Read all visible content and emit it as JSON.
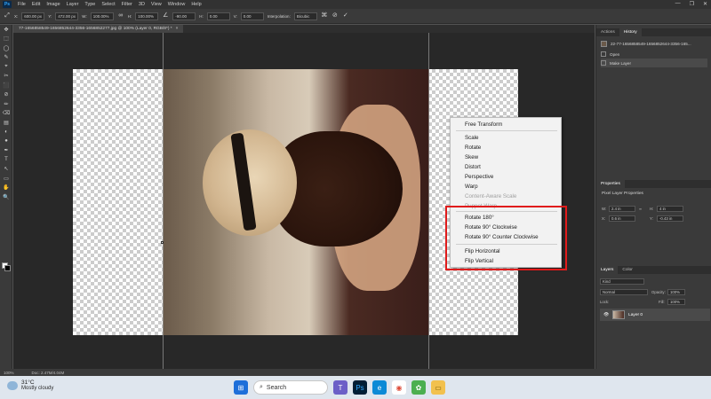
{
  "menubar": {
    "logo": "Ps",
    "items": [
      "File",
      "Edit",
      "Image",
      "Layer",
      "Type",
      "Select",
      "Filter",
      "3D",
      "View",
      "Window",
      "Help"
    ],
    "window_controls": [
      "—",
      "❐",
      "✕"
    ]
  },
  "options": {
    "x_label": "X:",
    "x_value": "600.00 px",
    "y_label": "Y:",
    "y_value": "472.00 px",
    "w_label": "W:",
    "w_value": "100.00%",
    "h_label": "H:",
    "h_value": "100.00%",
    "angle_value": "-90.00",
    "hskew_label": "H:",
    "hskew_value": "0.00",
    "vskew_label": "V:",
    "vskew_value": "0.00",
    "interpolation_label": "Interpolation:",
    "interpolation_value": "Bicubic"
  },
  "tools": [
    "✥",
    "⬚",
    "◯",
    "✎",
    "⌖",
    "✂",
    "⬛",
    "⊘",
    "✏",
    "⌫",
    "▤",
    "◐",
    "●",
    "✒",
    "T",
    "↖",
    "▭",
    "✋",
    "🔍"
  ],
  "document": {
    "tab_title": "77-1656858549-1656852644-3356-1656852277.jpg @ 100% (Layer 0, RGB/8*) *",
    "close": "×"
  },
  "context_menu": {
    "items": [
      {
        "label": "Free Transform",
        "disabled": false
      },
      {
        "label": "Scale",
        "disabled": false
      },
      {
        "label": "Rotate",
        "disabled": false
      },
      {
        "label": "Skew",
        "disabled": false
      },
      {
        "label": "Distort",
        "disabled": false
      },
      {
        "label": "Perspective",
        "disabled": false
      },
      {
        "label": "Warp",
        "disabled": false
      },
      {
        "label": "Content-Aware Scale",
        "disabled": true
      },
      {
        "label": "Puppet Warp",
        "disabled": true
      },
      {
        "label": "Rotate 180°",
        "disabled": false
      },
      {
        "label": "Rotate 90° Clockwise",
        "disabled": false
      },
      {
        "label": "Rotate 90° Counter Clockwise",
        "disabled": false
      },
      {
        "label": "Flip Horizontal",
        "disabled": false
      },
      {
        "label": "Flip Vertical",
        "disabled": false
      }
    ]
  },
  "history_panel": {
    "tabs": [
      "Actions",
      "History"
    ],
    "snapshot": "22-77-1656858549-1656852644-3356-165...",
    "entries": [
      "Open",
      "Make Layer"
    ]
  },
  "properties_panel": {
    "tab": "Properties",
    "title": "Pixel Layer Properties",
    "w_label": "W:",
    "w_value": "2.4 in",
    "h_label": "H:",
    "h_value": "4 in",
    "x_label": "X:",
    "x_value": "0.6 in",
    "y_label": "Y:",
    "y_value": "-0.43 in",
    "link_icon": "∞"
  },
  "layers_panel": {
    "tabs": [
      "Layers",
      "Color"
    ],
    "kind_label": "Kind",
    "blend_mode": "Normal",
    "opacity_label": "Opacity:",
    "opacity_value": "100%",
    "lock_label": "Lock:",
    "fill_label": "Fill:",
    "fill_value": "100%",
    "layer_name": "Layer 0"
  },
  "status": {
    "zoom": "100%",
    "doc": "Doc: 2.47M/4.04M"
  },
  "taskbar": {
    "temp": "31°C",
    "weather_desc": "Mostly cloudy",
    "search_label": "Search"
  }
}
